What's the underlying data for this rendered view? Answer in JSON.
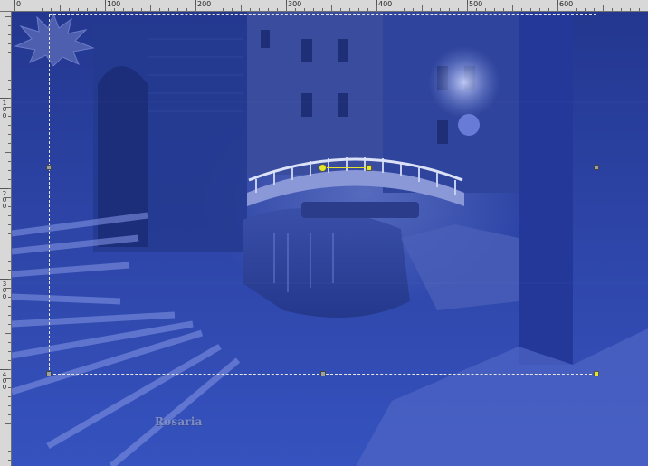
{
  "ruler": {
    "labels": [
      "0",
      "100",
      "200",
      "300",
      "400",
      "500",
      "600"
    ],
    "vertical_labels": [
      "100",
      "200",
      "300",
      "400"
    ]
  },
  "canvas": {
    "scene": "night-canal-bridge-blue",
    "colors": {
      "background": "#2d44a6",
      "selection": "#e8e8e0",
      "handle_active": "#e5e52a",
      "handle": "#9aa0a8"
    }
  },
  "watermark": {
    "text": "Rosaria"
  },
  "icons": [
    "pivot-handle-icon",
    "scale-handle-icon"
  ]
}
